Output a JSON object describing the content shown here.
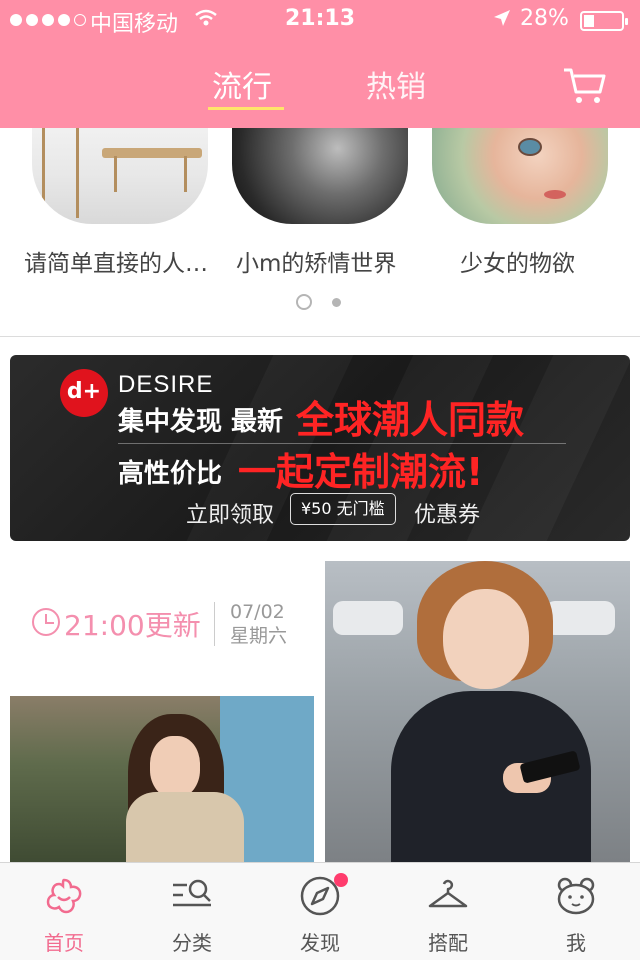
{
  "status_bar": {
    "carrier": "中国移动",
    "time": "21:13",
    "battery": "28%",
    "signal_icon": "signal-dots-icon",
    "wifi_icon": "wifi-icon",
    "location_icon": "location-arrow-icon",
    "battery_icon": "battery-icon"
  },
  "nav": {
    "tabs": [
      {
        "label": "流行",
        "active": true
      },
      {
        "label": "热销",
        "active": false
      }
    ],
    "cart_icon": "cart-icon"
  },
  "carousel": {
    "items": [
      {
        "label": "请简单直接的人…"
      },
      {
        "label": "小m的矫情世界"
      },
      {
        "label": "少女的物欲"
      }
    ],
    "page_count": 2,
    "current_page": 1
  },
  "banner": {
    "logo": "d+",
    "brand": "DESIRE",
    "line1_prefix": "集中发现 最新",
    "line1_highlight": "全球潮人同款",
    "line2_prefix": "高性价比",
    "line2_highlight": "一起定制潮流!",
    "cta_prefix": "立即领取",
    "coupon": "¥50 无门槛",
    "cta_suffix": "优惠券"
  },
  "update": {
    "time": "21:00更新",
    "date": "07/02",
    "weekday": "星期六"
  },
  "tabbar": {
    "items": [
      {
        "label": "首页",
        "icon": "flower-home-icon",
        "active": true
      },
      {
        "label": "分类",
        "icon": "category-search-icon",
        "active": false
      },
      {
        "label": "发现",
        "icon": "compass-icon",
        "active": false
      },
      {
        "label": "搭配",
        "icon": "hanger-icon",
        "active": false
      },
      {
        "label": "我",
        "icon": "bear-profile-icon",
        "active": false
      }
    ]
  },
  "colors": {
    "header_pink": "#ff8fa7",
    "accent_pink": "#f26b8f",
    "tab_underline": "#ffe46a",
    "banner_red": "#ff2424"
  }
}
